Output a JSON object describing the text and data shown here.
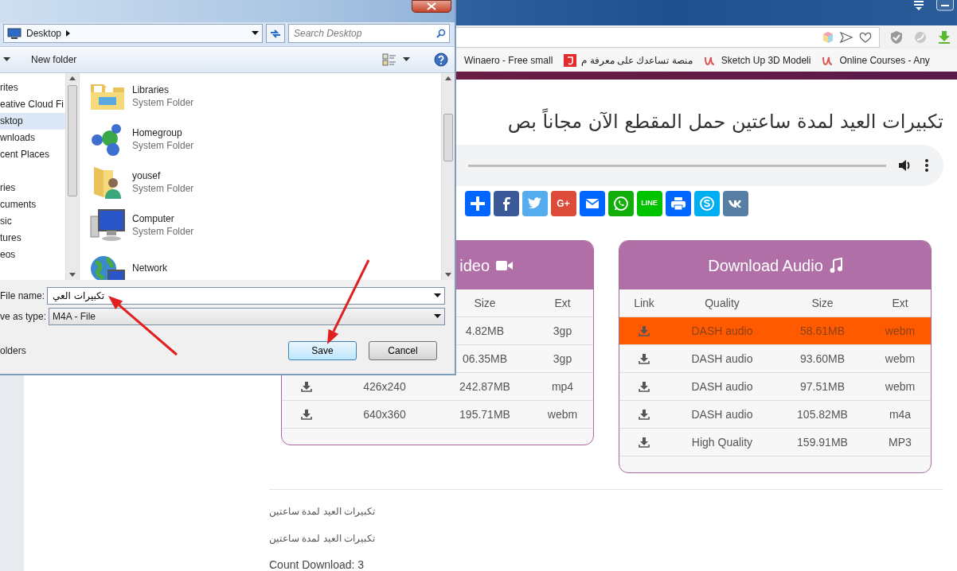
{
  "browser": {
    "bookmarks": [
      {
        "label": "Winaero - Free small",
        "kind": "none"
      },
      {
        "label": "منصة تساعدك على معرفة م",
        "kind": "j"
      },
      {
        "label": "Sketch Up 3D Modeli",
        "kind": "u"
      },
      {
        "label": "Online Courses - Any",
        "kind": "u"
      }
    ]
  },
  "page": {
    "title": "تكبيرات العيد لمدة ساعتين حمل المقطع الآن مجاناً بص",
    "share_buttons": [
      {
        "kind": "plus"
      },
      {
        "kind": "facebook"
      },
      {
        "kind": "twitter"
      },
      {
        "kind": "googleplus",
        "label": "G+"
      },
      {
        "kind": "email"
      },
      {
        "kind": "whatsapp"
      },
      {
        "kind": "line",
        "label": "LINE"
      },
      {
        "kind": "print"
      },
      {
        "kind": "skype"
      },
      {
        "kind": "vk"
      }
    ],
    "video_panel": {
      "title": "ideo",
      "columns": {
        "size": "Size",
        "ext": "Ext"
      },
      "rows": [
        {
          "size": "4.82MB",
          "ext": "3gp"
        },
        {
          "size": "06.35MB",
          "ext": "3gp"
        },
        {
          "link": true,
          "quality": "426x240",
          "size": "242.87MB",
          "ext": "mp4"
        },
        {
          "link": true,
          "quality": "640x360",
          "size": "195.71MB",
          "ext": "webm"
        }
      ]
    },
    "audio_panel": {
      "title": "Download Audio",
      "columns": {
        "link": "Link",
        "quality": "Quality",
        "size": "Size",
        "ext": "Ext"
      },
      "rows": [
        {
          "selected": true,
          "link": true,
          "quality": "DASH audio",
          "size": "58.61MB",
          "ext": "webm"
        },
        {
          "selected": false,
          "link": true,
          "quality": "DASH audio",
          "size": "93.60MB",
          "ext": "webm"
        },
        {
          "selected": false,
          "link": true,
          "quality": "DASH audio",
          "size": "97.51MB",
          "ext": "webm"
        },
        {
          "selected": false,
          "link": true,
          "quality": "DASH audio",
          "size": "105.82MB",
          "ext": "m4a"
        },
        {
          "selected": false,
          "link": true,
          "quality": "High Quality",
          "size": "159.91MB",
          "ext": "MP3"
        }
      ]
    },
    "description_lines": [
      "تكبيرات العيد لمدة ساعتين",
      "تكبيرات العيد لمدة ساعتين"
    ],
    "count_download": "Count Download: 3"
  },
  "dialog": {
    "location": "Desktop",
    "search": {
      "placeholder": "Search Desktop"
    },
    "new_folder": "New folder",
    "nav_items": [
      {
        "label": "rites",
        "kind": "group",
        "selected": false
      },
      {
        "label": "eative Cloud Fi",
        "kind": "item",
        "selected": false
      },
      {
        "label": "sktop",
        "kind": "item",
        "selected": true
      },
      {
        "label": "wnloads",
        "kind": "item",
        "selected": false
      },
      {
        "label": "cent Places",
        "kind": "item",
        "selected": false
      },
      {
        "label": "ries",
        "kind": "group",
        "selected": false
      },
      {
        "label": "cuments",
        "kind": "item",
        "selected": false
      },
      {
        "label": "sic",
        "kind": "item",
        "selected": false
      },
      {
        "label": "tures",
        "kind": "item",
        "selected": false
      },
      {
        "label": "eos",
        "kind": "item",
        "selected": false
      }
    ],
    "files": [
      {
        "name": "Libraries",
        "type": "System Folder",
        "kind": "libraries"
      },
      {
        "name": "Homegroup",
        "type": "System Folder",
        "kind": "homegroup"
      },
      {
        "name": "yousef",
        "type": "System Folder",
        "kind": "user"
      },
      {
        "name": "Computer",
        "type": "System Folder",
        "kind": "computer"
      },
      {
        "name": "Network",
        "kind": "network"
      }
    ],
    "file_name": {
      "label": "File name:",
      "value": "تكبيرات العي"
    },
    "save_as_type": {
      "label": "ve as type:",
      "value": "M4A - File"
    },
    "hide_folders": "olders",
    "buttons": [
      {
        "label": "Save",
        "default": true
      },
      {
        "label": "Cancel",
        "default": false
      }
    ]
  }
}
